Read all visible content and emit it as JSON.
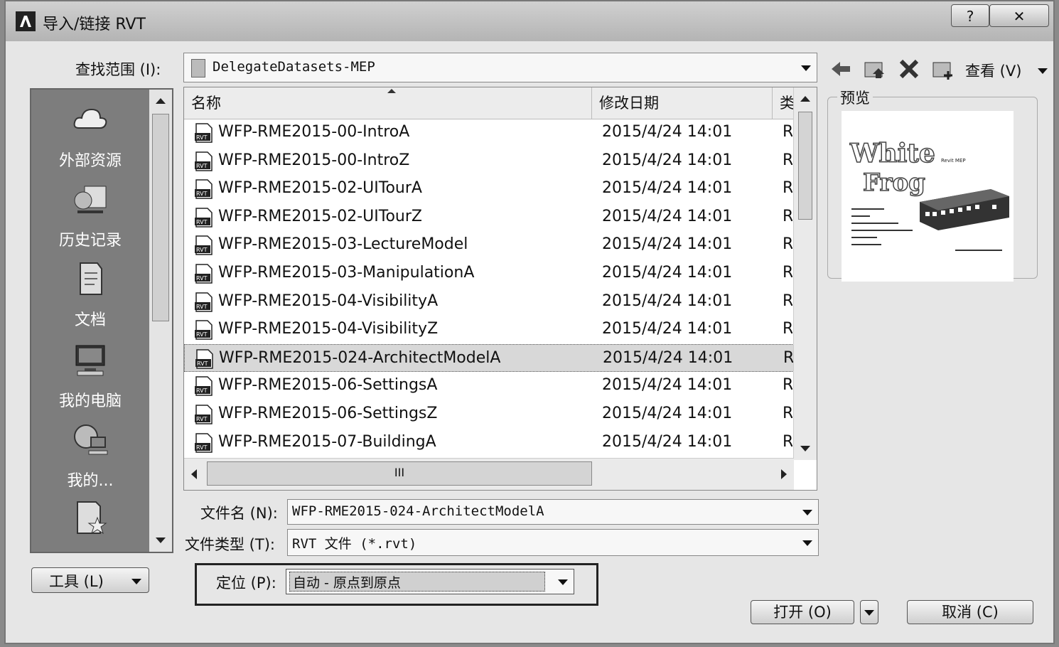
{
  "window": {
    "title": "导入/链接 RVT",
    "help_label": "?",
    "close_label": "✕"
  },
  "lookin": {
    "label": "查找范围 (I):",
    "value": "DelegateDatasets-MEP"
  },
  "toolbar": {
    "view_label": "查看 (V)"
  },
  "places": [
    {
      "label": "外部资源",
      "icon": "cloud-icon"
    },
    {
      "label": "历史记录",
      "icon": "history-icon"
    },
    {
      "label": "文档",
      "icon": "documents-icon"
    },
    {
      "label": "我的电脑",
      "icon": "computer-icon"
    },
    {
      "label": "我的...",
      "icon": "network-icon"
    },
    {
      "label": "",
      "icon": "favorites-icon"
    }
  ],
  "filelist": {
    "columns": {
      "name": "名称",
      "date": "修改日期",
      "type": "类"
    },
    "scroll_mark": "III",
    "rows": [
      {
        "name": "WFP-RME2015-00-IntroA",
        "date": "2015/4/24 14:01",
        "type": "R",
        "icon_label": "RVT"
      },
      {
        "name": "WFP-RME2015-00-IntroZ",
        "date": "2015/4/24 14:01",
        "type": "R",
        "icon_label": "RVT"
      },
      {
        "name": "WFP-RME2015-02-UITourA",
        "date": "2015/4/24 14:01",
        "type": "R",
        "icon_label": "RVT"
      },
      {
        "name": "WFP-RME2015-02-UITourZ",
        "date": "2015/4/24 14:01",
        "type": "R",
        "icon_label": "RVT"
      },
      {
        "name": "WFP-RME2015-03-LectureModel",
        "date": "2015/4/24 14:01",
        "type": "R",
        "icon_label": "RVT"
      },
      {
        "name": "WFP-RME2015-03-ManipulationA",
        "date": "2015/4/24 14:01",
        "type": "R",
        "icon_label": "RVT"
      },
      {
        "name": "WFP-RME2015-04-VisibilityA",
        "date": "2015/4/24 14:01",
        "type": "R",
        "icon_label": "RVT"
      },
      {
        "name": "WFP-RME2015-04-VisibilityZ",
        "date": "2015/4/24 14:01",
        "type": "R",
        "icon_label": "RVT"
      },
      {
        "name": "WFP-RME2015-024-ArchitectModelA",
        "date": "2015/4/24 14:01",
        "type": "R",
        "icon_label": "RVT",
        "selected": true
      },
      {
        "name": "WFP-RME2015-06-SettingsA",
        "date": "2015/4/24 14:01",
        "type": "R",
        "icon_label": "RVT"
      },
      {
        "name": "WFP-RME2015-06-SettingsZ",
        "date": "2015/4/24 14:01",
        "type": "R",
        "icon_label": "RVT"
      },
      {
        "name": "WFP-RME2015-07-BuildingA",
        "date": "2015/4/24 14:01",
        "type": "R",
        "icon_label": "RVT"
      }
    ]
  },
  "preview": {
    "label": "预览",
    "logo_top": "White",
    "logo_bottom": "Frog",
    "logo_tag": "Revit MEP"
  },
  "filename": {
    "label": "文件名 (N):",
    "value": "WFP-RME2015-024-ArchitectModelA"
  },
  "filetype": {
    "label": "文件类型 (T):",
    "value": "RVT 文件 (*.rvt)"
  },
  "position": {
    "label": "定位 (P):",
    "value": "自动 - 原点到原点"
  },
  "tools": {
    "label": "工具 (L)"
  },
  "buttons": {
    "open": "打开 (O)",
    "cancel": "取消 (C)"
  }
}
